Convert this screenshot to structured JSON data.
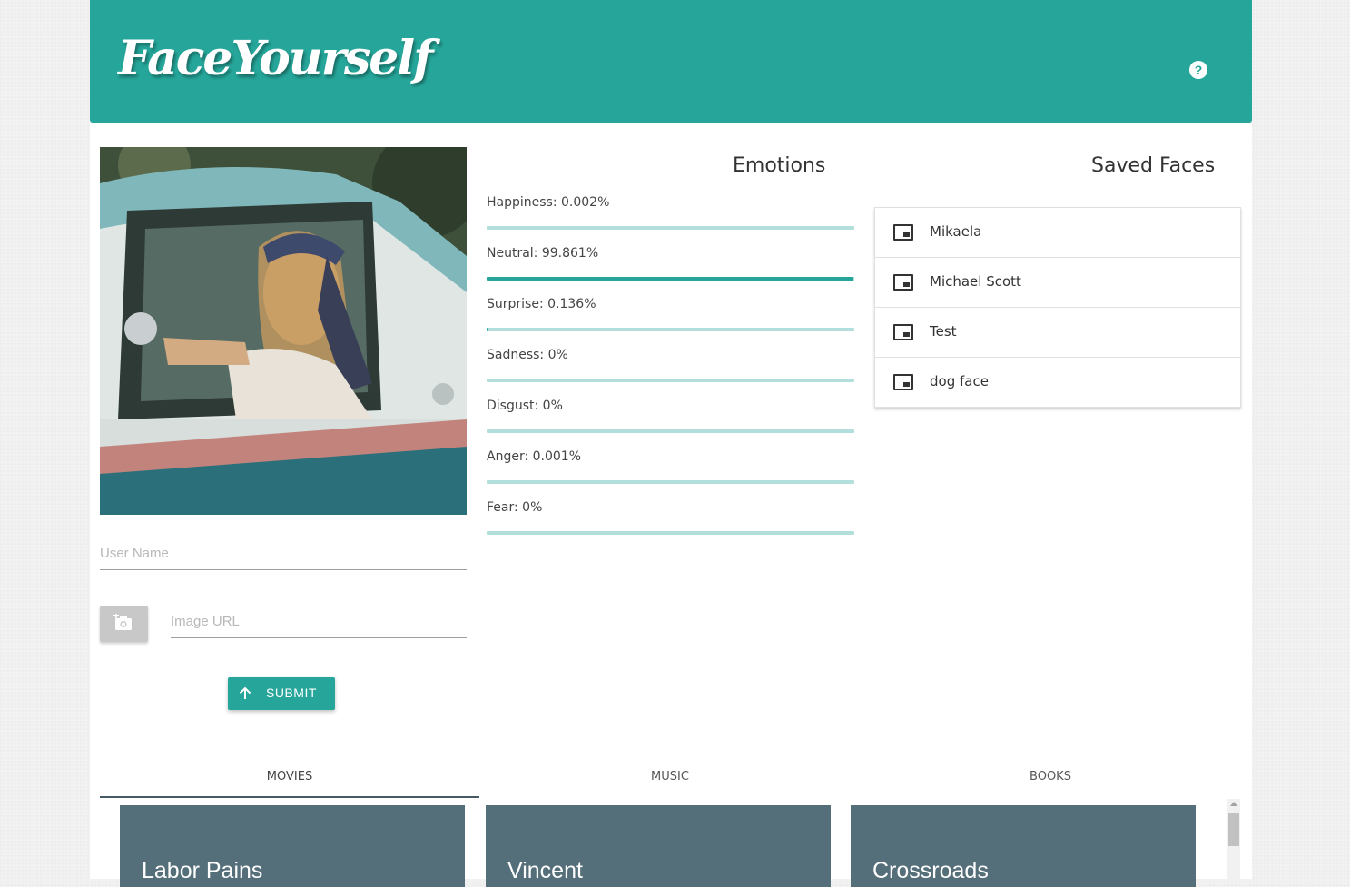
{
  "app": {
    "brand": "FaceYourself",
    "help_icon": "?",
    "accent_color": "#26a69a"
  },
  "left": {
    "photo_icon": "portrait-photo",
    "username_placeholder": "User Name",
    "username_value": "",
    "imageurl_placeholder": "Image URL",
    "imageurl_value": "",
    "camera_icon": "add-photo-icon",
    "submit_label": "SUBMIT"
  },
  "emotions": {
    "title": "Emotions",
    "items": [
      {
        "label": "Happiness: 0.002%",
        "value": 0.002
      },
      {
        "label": "Neutral: 99.861%",
        "value": 99.861
      },
      {
        "label": "Surprise: 0.136%",
        "value": 0.136
      },
      {
        "label": "Sadness: 0%",
        "value": 0
      },
      {
        "label": "Disgust: 0%",
        "value": 0
      },
      {
        "label": "Anger: 0.001%",
        "value": 0.001
      },
      {
        "label": "Fear: 0%",
        "value": 0
      }
    ]
  },
  "saved_faces": {
    "title": "Saved Faces",
    "items": [
      {
        "name": "Mikaela"
      },
      {
        "name": "Michael Scott"
      },
      {
        "name": "Test"
      },
      {
        "name": "dog face"
      }
    ]
  },
  "tabs": {
    "items": [
      {
        "label": "MOVIES",
        "active": true
      },
      {
        "label": "MUSIC",
        "active": false
      },
      {
        "label": "BOOKS",
        "active": false
      }
    ]
  },
  "cards": {
    "items": [
      {
        "title": "Labor Pains"
      },
      {
        "title": "Vincent"
      },
      {
        "title": "Crossroads"
      }
    ]
  }
}
